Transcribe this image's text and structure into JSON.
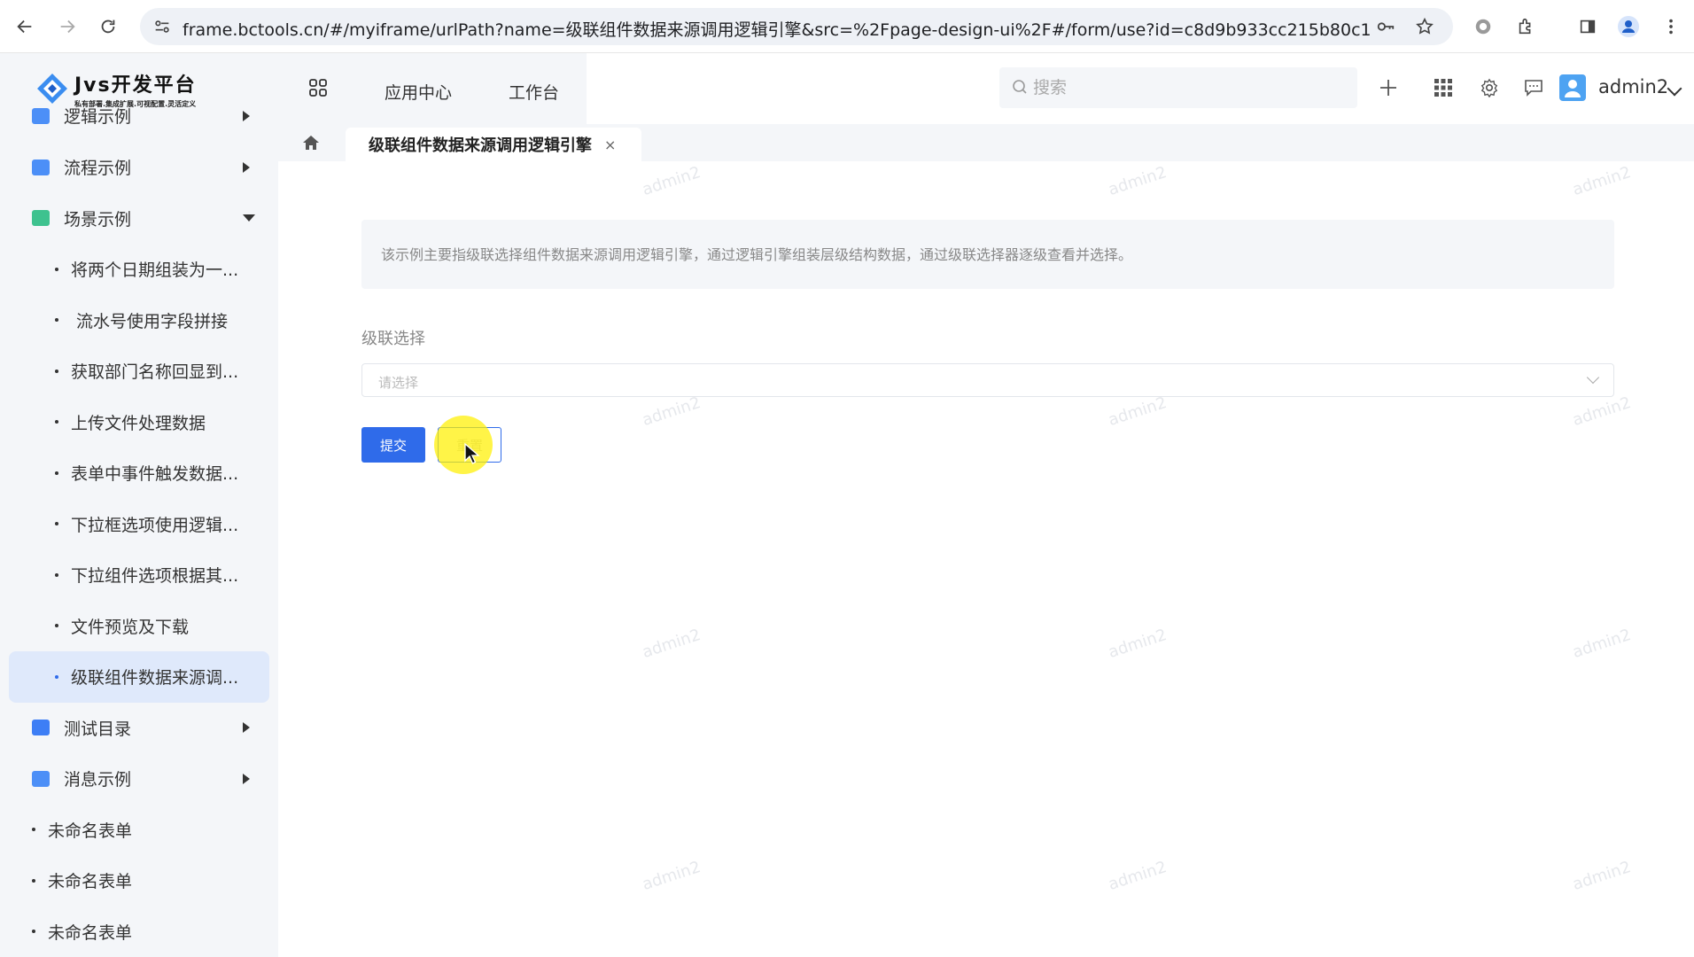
{
  "browser": {
    "url": "frame.bctools.cn/#/myiframe/urlPath?name=级联组件数据来源调用逻辑引擎&src=%2Fpage-design-ui%2F#/form/use?id=c8d9b933cc215b80c1f7ce24a9..."
  },
  "logo": {
    "title": "Jvs开发平台",
    "subtitle": "私有部署.集成扩展.可视配置.灵活定义"
  },
  "sidebar": {
    "partial_item": "逻辑示例",
    "items": [
      {
        "label": "流程示例",
        "icon": "folder-icon",
        "icon_color": "#4c8ff7",
        "state": "collapsed"
      },
      {
        "label": "场景示例",
        "icon": "doc-icon",
        "icon_color": "#3ec28f",
        "state": "expanded"
      }
    ],
    "sub_items": [
      "将两个日期组装为一...",
      "流水号使用字段拼接",
      "获取部门名称回显到...",
      "上传文件处理数据",
      "表单中事件触发数据...",
      "下拉框选项使用逻辑...",
      "下拉组件选项根据其...",
      "文件预览及下载",
      "级联组件数据来源调..."
    ],
    "after_items": [
      {
        "label": "测试目录",
        "icon": "list-icon",
        "icon_color": "#3d7ef5",
        "state": "collapsed"
      },
      {
        "label": "消息示例",
        "icon": "folder-icon",
        "icon_color": "#4c8ff7",
        "state": "collapsed"
      }
    ],
    "root_items": [
      "未命名表单",
      "未命名表单",
      "未命名表单"
    ]
  },
  "header": {
    "nav": [
      "应用中心",
      "工作台"
    ],
    "search_placeholder": "搜索",
    "user": "admin2"
  },
  "tabs": {
    "active": "级联组件数据来源调用逻辑引擎",
    "close": "×"
  },
  "form": {
    "description": "该示例主要指级联选择组件数据来源调用逻辑引擎，通过逻辑引擎组装层级结构数据，通过级联选择器逐级查看并选择。",
    "field_label": "级联选择",
    "select_placeholder": "请选择",
    "submit": "提交",
    "reset": "重置"
  },
  "watermark": "admin2",
  "colors": {
    "primary": "#2f6bea",
    "sidebar_bg": "#f4f6f9",
    "active_bg": "#dfe9fb"
  }
}
